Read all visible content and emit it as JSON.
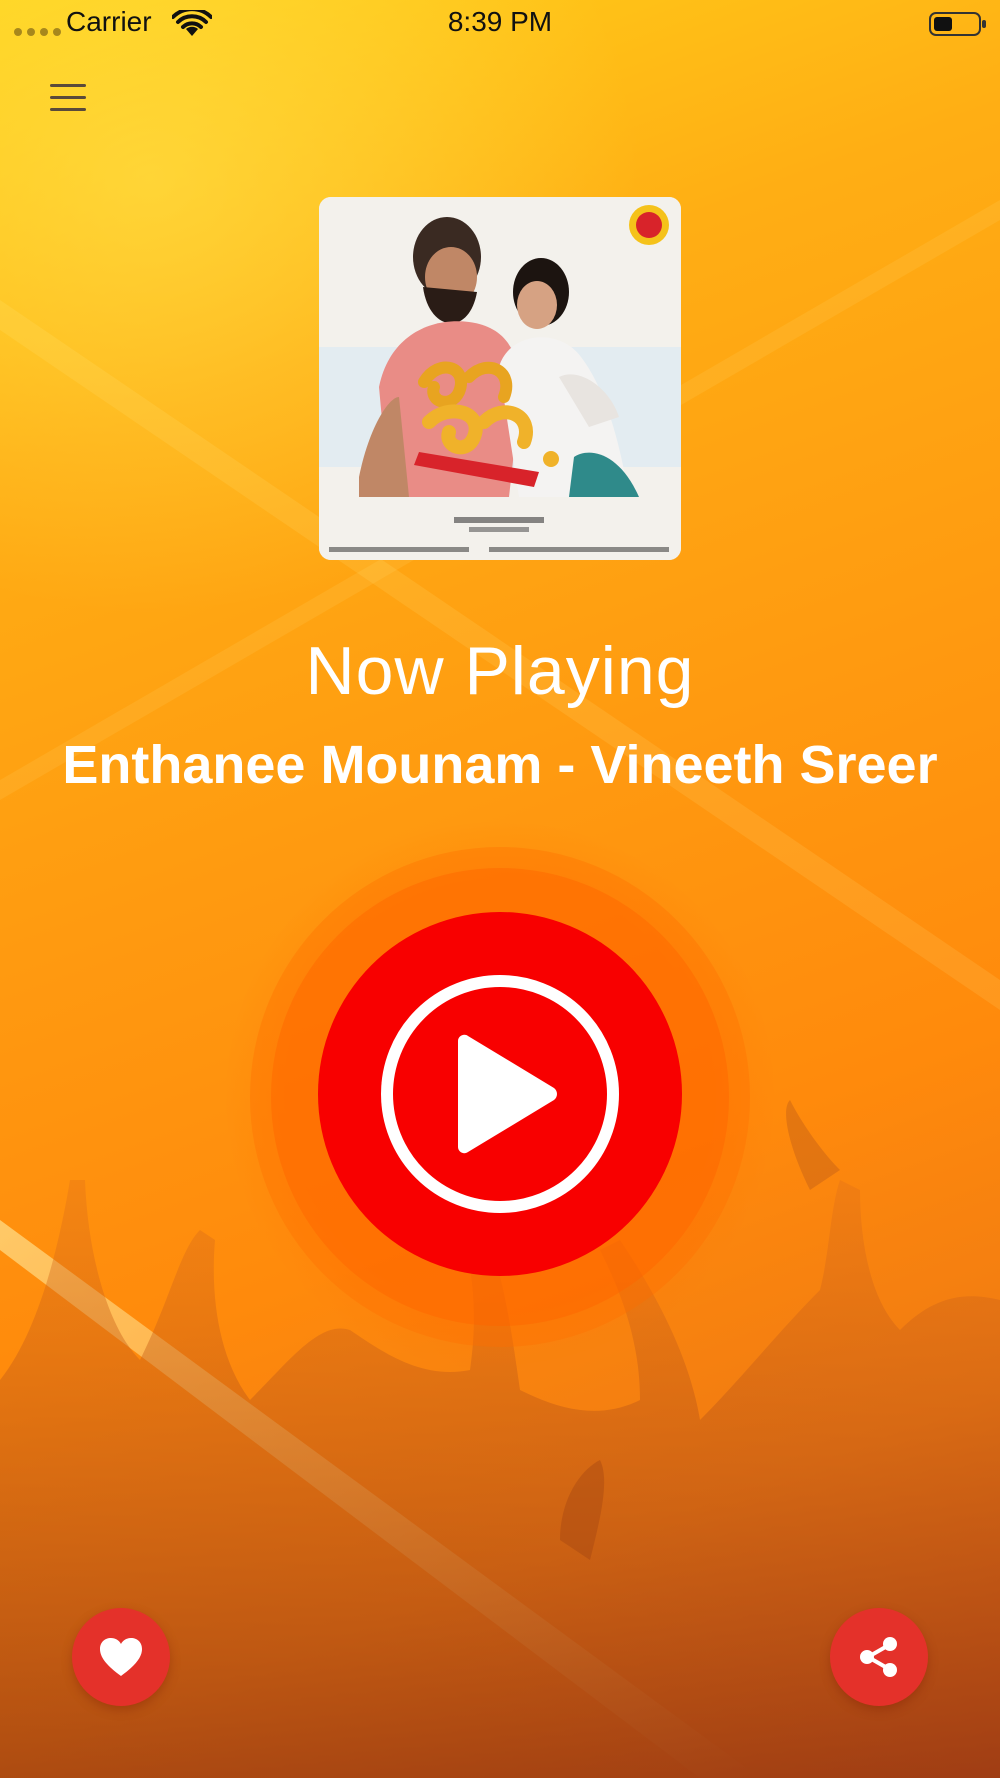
{
  "status_bar": {
    "carrier": "Carrier",
    "time": "8:39 PM",
    "wifi_icon": "wifi-icon",
    "battery_icon": "battery-icon"
  },
  "header": {
    "menu_icon": "hamburger-menu-icon"
  },
  "album": {
    "artwork": "album-art"
  },
  "player": {
    "heading": "Now Playing",
    "track": "Enthanee Mounam - Vineeth Sreer",
    "control_icon": "play-icon",
    "control_color": "#f80000"
  },
  "actions": {
    "favorite_icon": "heart-icon",
    "share_icon": "share-icon",
    "fab_color": "#e4312a"
  },
  "theme": {
    "background_top": "#ffd21a",
    "background_bottom": "#c8501a",
    "text_color": "#ffffff"
  }
}
